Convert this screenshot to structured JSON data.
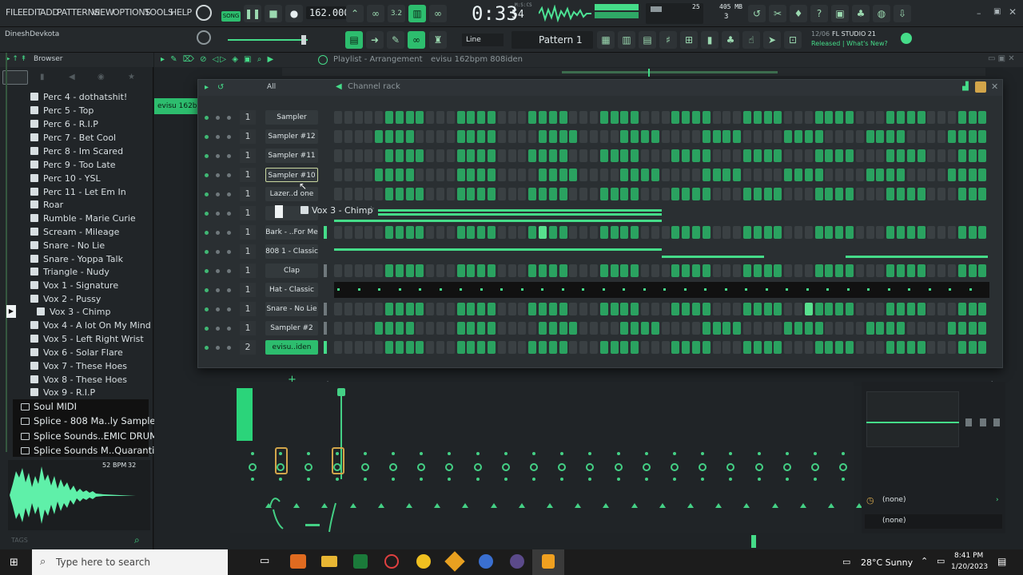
{
  "menu": [
    "FILE",
    "EDIT",
    "ADD",
    "PATTERNS",
    "VIEW",
    "OPTIONS",
    "TOOLS",
    "HELP"
  ],
  "transport": {
    "mode": "SONG",
    "tempo": "162.000",
    "time": "0:33",
    "time_small": "54",
    "time_label": "M:S:CS",
    "cpu": "25",
    "mem": "405 MB",
    "voices": "3"
  },
  "user": "DineshDevkota",
  "snap": "Line",
  "pattern": "Pattern 1",
  "hint": {
    "date": "12/06",
    "app": "FL STUDIO 21",
    "news": "Released | What's New?"
  },
  "browser": {
    "title": "Browser",
    "items": [
      "Perc 4 - dothatshit!",
      "Perc 5 - Top",
      "Perc 6 - R.I.P",
      "Perc 7 - Bet Cool",
      "Perc 8 - Im Scared",
      "Perc 9 - Too Late",
      "Perc 10 - YSL",
      "Perc 11 - Let Em In",
      "Roar",
      "Rumble - Marie Curie",
      "Scream - Mileage",
      "Snare - No Lie",
      "Snare - Yoppa Talk",
      "Triangle - Nudy",
      "Vox 1 - Signature",
      "Vox 2 - Pussy",
      "Vox 3 - Chimp",
      "Vox 4 - A lot On My Mind",
      "Vox 5 - Left Right Wrist",
      "Vox 6 - Solar Flare",
      "Vox 7 - These Hoes",
      "Vox 8 - These Hoes",
      "Vox 9 - R.I.P"
    ],
    "folders": [
      "Soul MIDI",
      "Splice - 808 Ma..ly Sample Pack",
      "Splice Sounds..EMIC DRUM KIT",
      "Splice Sounds M..Quarantine Kit"
    ],
    "wave_info": "52",
    "wave_bpm": "BPM",
    "wave_info2": "32",
    "tags": "TAGS"
  },
  "playlist": {
    "title": "Playlist - Arrangement",
    "name": "evisu 162bpm 808iden",
    "clip": "evisu 162bpm"
  },
  "rack": {
    "title": "Channel rack",
    "filter": "All",
    "drag_label": "Vox 3 - Chimp",
    "channels": [
      {
        "name": "Sampler",
        "num": "1"
      },
      {
        "name": "Sampler #12",
        "num": "1"
      },
      {
        "name": "Sampler #11",
        "num": "1"
      },
      {
        "name": "Sampler #10",
        "num": "1"
      },
      {
        "name": "Lazer..d one",
        "num": "1"
      },
      {
        "name": "",
        "num": "1"
      },
      {
        "name": "Bark - ..For Me",
        "num": "1"
      },
      {
        "name": "808 1 - Classic",
        "num": "1"
      },
      {
        "name": "Clap",
        "num": "1"
      },
      {
        "name": "Hat - Classic",
        "num": "1"
      },
      {
        "name": "Snare - No Lie",
        "num": "1"
      },
      {
        "name": "Sampler #2",
        "num": "1"
      },
      {
        "name": "evisu..iden",
        "num": "2"
      }
    ]
  },
  "mixer_side": {
    "slot1": "(none)",
    "slot2": "(none)"
  },
  "taskbar": {
    "search": "Type here to search",
    "weather": "28°C  Sunny",
    "time": "8:41 PM",
    "date": "1/20/2023"
  }
}
